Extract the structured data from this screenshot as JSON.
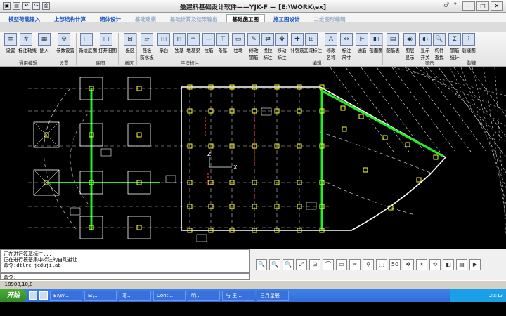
{
  "titlebar": {
    "title": "盈建科基础设计软件——YJK-F — [E:\\WORK\\ex]",
    "help_items": [
      "♂",
      "?"
    ],
    "win_buttons": [
      "–",
      "□",
      "✕"
    ]
  },
  "menu": {
    "tabs": [
      "模型荷载输入",
      "上部结构计算",
      "砌体设计",
      "基础建模",
      "基础计算及结果输出",
      "基础施工图",
      "施工图设计",
      "二维图形编辑"
    ],
    "active_index": 5
  },
  "ribbon": {
    "buttons": [
      {
        "label": "设置",
        "icon": "≡"
      },
      {
        "label": "标注轴线",
        "icon": "#"
      },
      {
        "label": "插入",
        "icon": "▦"
      },
      {
        "label": "参数设置",
        "icon": "⚙"
      },
      {
        "label": "新绘底图",
        "icon": "□"
      },
      {
        "label": "打开旧图",
        "icon": "▢"
      },
      {
        "label": "板区",
        "icon": "⊠"
      },
      {
        "label": "筏板",
        "label2": "防水板",
        "icon": "▱"
      },
      {
        "label": "承台",
        "icon": "◫"
      },
      {
        "label": "独基",
        "icon": "⊓"
      },
      {
        "label": "地基梁",
        "icon": "═"
      },
      {
        "label": "拉筋",
        "icon": "—"
      },
      {
        "label": "条基",
        "icon": "⊤"
      },
      {
        "label": "柱墩",
        "icon": "▭"
      },
      {
        "label": "修改",
        "label2": "钢筋",
        "icon": "✎"
      },
      {
        "label": "换位",
        "label2": "标注",
        "icon": "⇄"
      },
      {
        "label": "移动",
        "label2": "标注",
        "icon": "✥"
      },
      {
        "label": "补强筋",
        "icon": "✚"
      },
      {
        "label": "区域标注",
        "icon": "⊞"
      },
      {
        "label": "修改",
        "label2": "名称",
        "icon": "A"
      },
      {
        "label": "标注",
        "label2": "尺寸",
        "icon": "↔"
      },
      {
        "label": "通筋",
        "icon": "⊩"
      },
      {
        "label": "剖面图",
        "icon": "◧"
      },
      {
        "label": "配筋表",
        "icon": "▤"
      },
      {
        "label": "图层",
        "label2": "显示",
        "icon": "◉"
      },
      {
        "label": "显示",
        "label2": "开关",
        "icon": "◐"
      },
      {
        "label": "构件",
        "label2": "查找",
        "icon": "🔍"
      },
      {
        "label": "钢筋",
        "label2": "统计",
        "icon": "Σ"
      },
      {
        "label": "裂缝图",
        "icon": "⌇"
      }
    ],
    "groups": [
      "通用编辑",
      "设置",
      "底图",
      "板区",
      "平法标注",
      "编辑",
      "显示",
      "裂缝"
    ]
  },
  "canvas": {
    "axis_x": "X",
    "axis_z": "Z",
    "colors": {
      "structure": "#ffffff",
      "beam": "#22ee22",
      "node": "#ffff33",
      "rebar": "#ff3333",
      "dashed": "#cccccc"
    }
  },
  "command": {
    "lines": [
      "正在进行筏基标注...",
      "正在进行筏基集中标注的自动避让...",
      "命令:dtlrc_jcdujilab"
    ],
    "input_label": "命令:"
  },
  "tools": [
    "🔍",
    "🔍",
    "🔍",
    "⤢",
    "⊡",
    "⌒",
    "▭",
    "✂",
    "⚲",
    "⬚",
    "50",
    "✥",
    "✕",
    "⟲",
    "◧",
    "▤",
    "▶"
  ],
  "statusbar": {
    "coords": "-18908,10,0"
  },
  "taskbar": {
    "start": "开始",
    "tasks": [
      "E:\\W...",
      "E:\\...",
      "写...",
      "Cont...",
      "明...",
      "与 王...",
      "日月星辰"
    ],
    "time": "20:13"
  }
}
